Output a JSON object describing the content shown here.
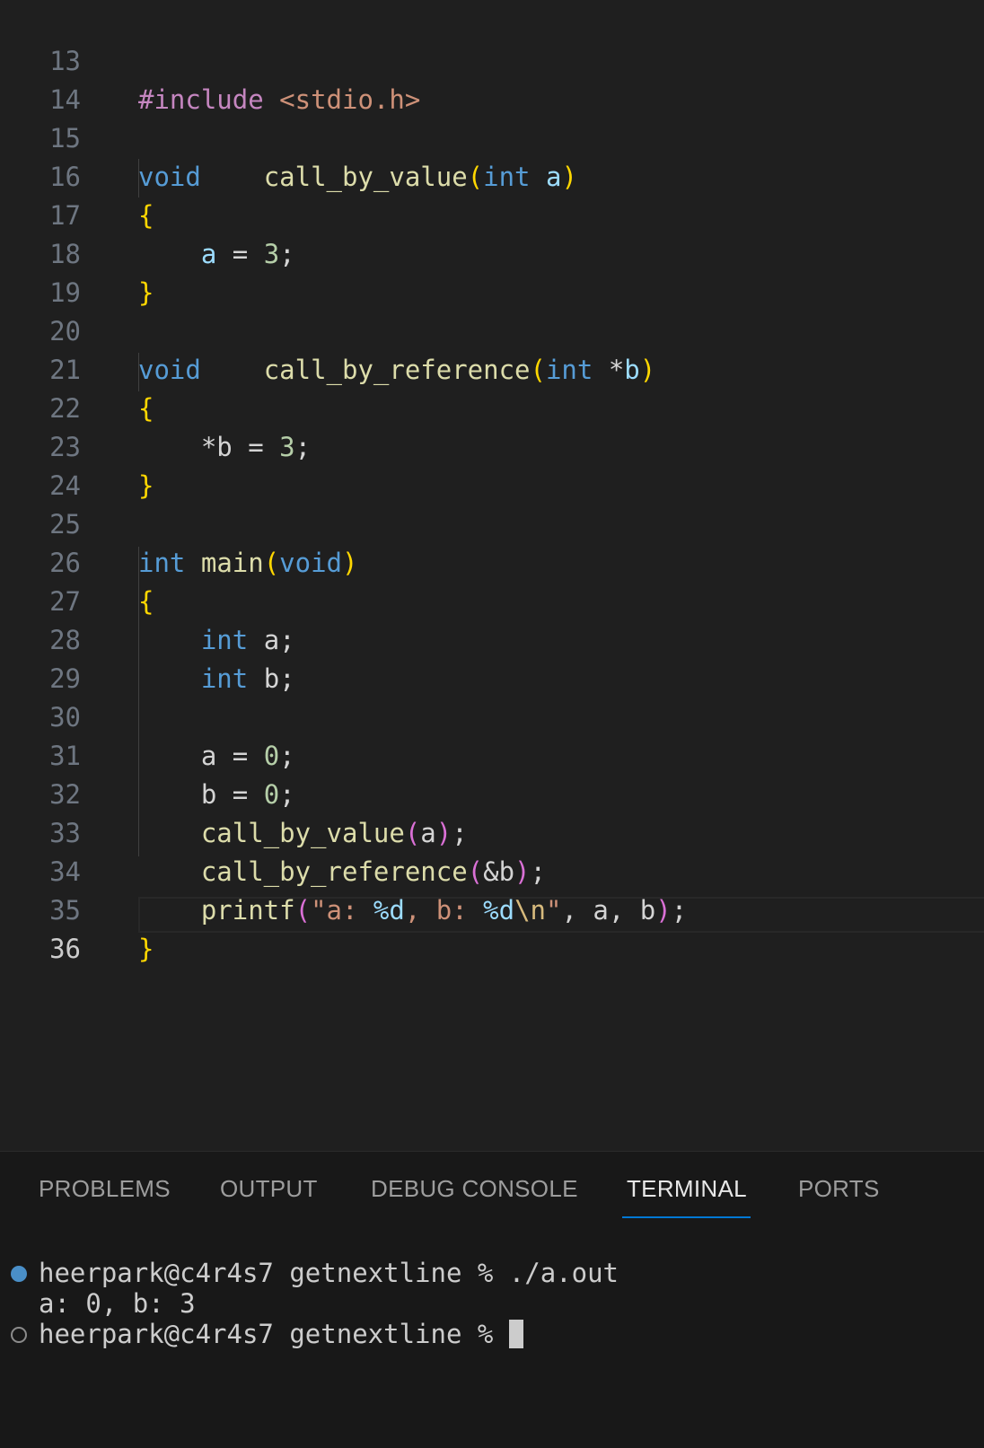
{
  "editor": {
    "line_numbers": [
      "13",
      "14",
      "15",
      "16",
      "17",
      "18",
      "19",
      "20",
      "21",
      "22",
      "23",
      "24",
      "25",
      "26",
      "27",
      "28",
      "29",
      "30",
      "31",
      "32",
      "33",
      "34",
      "35",
      "36"
    ],
    "active_line": "36",
    "code": {
      "l13_pp": "#include",
      "l13_str": "<stdio.h>",
      "l15_kw": "void",
      "l15_fn": "call_by_value",
      "l15_open": "(",
      "l15_type": "int",
      "l15_param": "a",
      "l15_close": ")",
      "l16": "{",
      "l17_var": "a",
      "l17_op": " = ",
      "l17_num": "3",
      "l17_semi": ";",
      "l18": "}",
      "l20_kw": "void",
      "l20_fn": "call_by_reference",
      "l20_open": "(",
      "l20_type": "int",
      "l20_ptr": "*",
      "l20_param": "b",
      "l20_close": ")",
      "l21": "{",
      "l22_ptr": "*b",
      "l22_op": " = ",
      "l22_num": "3",
      "l22_semi": ";",
      "l23": "}",
      "l25_kw": "int",
      "l25_fn": "main",
      "l25_open": "(",
      "l25_void": "void",
      "l25_close": ")",
      "l26": "{",
      "l27_kw": "int",
      "l27_var": "a;",
      "l28_kw": "int",
      "l28_var": "b;",
      "l30_var": "a",
      "l30_op": " = ",
      "l30_num": "0",
      "l30_semi": ";",
      "l31_var": "b",
      "l31_op": " = ",
      "l31_num": "0",
      "l31_semi": ";",
      "l32_fn": "call_by_value",
      "l32_open": "(",
      "l32_arg": "a",
      "l32_close": ")",
      "l32_semi": ";",
      "l33_fn": "call_by_reference",
      "l33_open": "(",
      "l33_arg": "&b",
      "l33_close": ")",
      "l33_semi": ";",
      "l34_fn": "printf",
      "l34_open": "(",
      "l34_s1": "\"a: ",
      "l34_f1": "%d",
      "l34_s2": ", b: ",
      "l34_f2": "%d",
      "l34_esc": "\\n",
      "l34_s3": "\"",
      "l34_args": ", a, b",
      "l34_close": ")",
      "l34_semi": ";",
      "l35": "}"
    }
  },
  "panel": {
    "tabs": [
      "PROBLEMS",
      "OUTPUT",
      "DEBUG CONSOLE",
      "TERMINAL",
      "PORTS"
    ],
    "active_tab": "TERMINAL",
    "terminal": {
      "line1": "heerpark@c4r4s7 getnextline % ./a.out",
      "line2": "a: 0, b: 3",
      "line3": "heerpark@c4r4s7 getnextline % "
    }
  },
  "colors": {
    "background": "#1f1f1f",
    "keyword": "#569cd6",
    "function": "#dcdcaa",
    "string": "#ce9178",
    "number": "#b5cea8",
    "bracket": "#ffd700",
    "accent": "#0078d4"
  }
}
